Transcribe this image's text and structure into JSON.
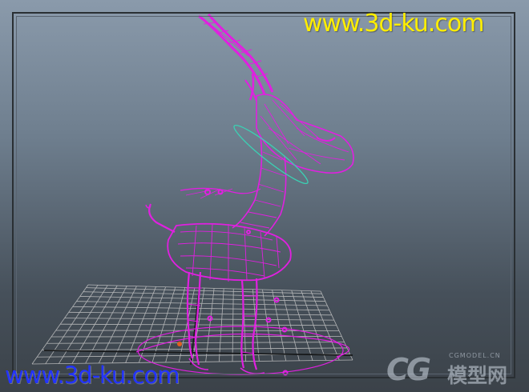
{
  "watermark": {
    "top_text": "www.3d-ku.com",
    "bottom_text": "www.3d-ku.com",
    "top_color": "#ffee00",
    "bottom_color": "#2233ff"
  },
  "logo": {
    "mark": "CG",
    "small_text": "CGMODEL.CN",
    "name": "模型网"
  },
  "scene": {
    "wireframe_color": "#e020e0",
    "selection_ring_color": "#3ad2b4",
    "grid_color": "#c8c8c8",
    "icons": [
      "deer-wireframe-model",
      "ground-grid",
      "selection-ring",
      "control-curve"
    ]
  }
}
